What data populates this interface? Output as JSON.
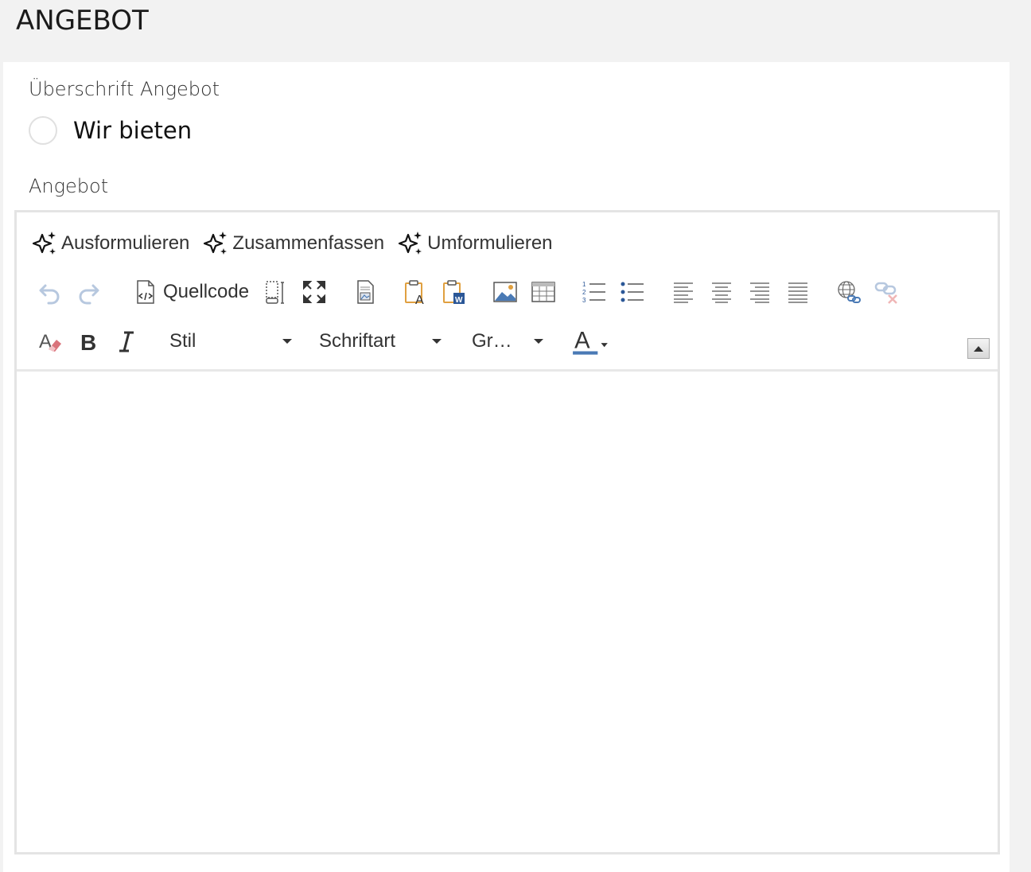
{
  "page": {
    "section_title": "ANGEBOT"
  },
  "form": {
    "heading_label": "Überschrift Angebot",
    "heading_option": "Wir bieten",
    "body_label": "Angebot"
  },
  "editor": {
    "ai_actions": [
      "Ausformulieren",
      "Zusammenfassen",
      "Umformulieren"
    ],
    "source_label": "Quellcode",
    "style_combo": "Stil",
    "font_combo": "Schriftart",
    "size_combo": "Gr…",
    "text_color_letter": "A",
    "icons": {
      "ai": "sparkles-icon",
      "undo": "undo-icon",
      "redo": "redo-icon",
      "source": "source-code-icon",
      "show_blocks": "show-blocks-icon",
      "maximize": "maximize-icon",
      "preview": "preview-icon",
      "paste_text": "paste-as-text-icon",
      "paste_word": "paste-from-word-icon",
      "image": "image-icon",
      "table": "table-icon",
      "numbered_list": "numbered-list-icon",
      "bulleted_list": "bulleted-list-icon",
      "align_left": "align-left-icon",
      "align_center": "align-center-icon",
      "align_right": "align-right-icon",
      "align_justify": "align-justify-icon",
      "link": "link-icon",
      "unlink": "unlink-icon",
      "remove_format": "remove-format-icon",
      "bold": "bold-icon",
      "italic": "italic-icon",
      "text_color": "text-color-icon",
      "collapse": "collapse-toolbar-icon"
    },
    "colors": {
      "accent_blue": "#4a7ab5",
      "paste_orange": "#e0a040",
      "eraser_pink": "#d9737b",
      "disabled_blue": "#b7c8df"
    }
  }
}
